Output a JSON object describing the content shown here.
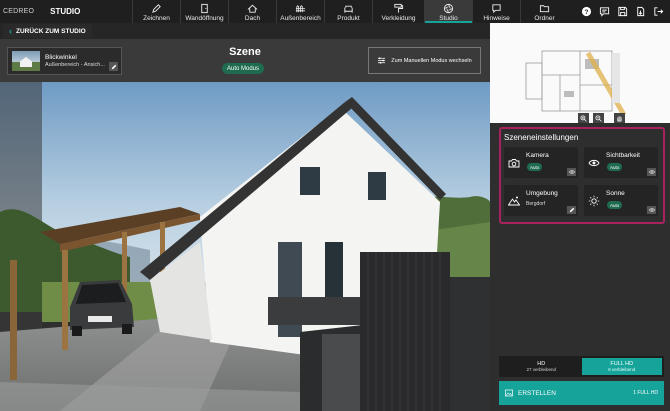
{
  "brand": {
    "logo_text": "CEDREO",
    "section": "STUDIO"
  },
  "nav": [
    {
      "label": "Zeichnen",
      "icon": "pencil-icon"
    },
    {
      "label": "Wandöffnung",
      "icon": "door-icon"
    },
    {
      "label": "Dach",
      "icon": "roof-icon"
    },
    {
      "label": "Außenbereich",
      "icon": "fence-icon"
    },
    {
      "label": "Produkt",
      "icon": "sofa-icon"
    },
    {
      "label": "Verkleidung",
      "icon": "paint-roller-icon"
    },
    {
      "label": "Studio",
      "icon": "camera-aperture-icon",
      "active": true
    },
    {
      "label": "Hinweise",
      "icon": "comment-icon"
    },
    {
      "label": "Ordner",
      "icon": "folder-icon"
    }
  ],
  "topbar_icons": [
    "help-icon",
    "chat-icon",
    "save-icon",
    "export-icon",
    "logout-icon"
  ],
  "subbar": {
    "back_label": "ZURÜCK ZUM STUDIO"
  },
  "view": {
    "title": "Blickwinkel",
    "subtitle": "Außenbereich - Ansich..."
  },
  "scene": {
    "title": "Szene",
    "mode": "Auto Modus",
    "manual_button": "Zum Manuellen Modus wechseln"
  },
  "settings": {
    "title": "Szeneneinstellungen",
    "cards": [
      {
        "label": "Kamera",
        "badge": "Auto",
        "icon": "camera-icon",
        "action": "eye-icon"
      },
      {
        "label": "Sichtbarkeit",
        "badge": "Auto",
        "icon": "eye-icon",
        "action": "eye-icon"
      },
      {
        "label": "Umgebung",
        "sub": "Bergdorf",
        "icon": "mountain-icon",
        "action": "pencil-icon"
      },
      {
        "label": "Sonne",
        "badge": "Auto",
        "icon": "sun-icon",
        "action": "eye-icon"
      }
    ]
  },
  "resolution": {
    "options": [
      {
        "label": "HD",
        "remaining": "27 verbleibend",
        "active": false
      },
      {
        "label": "FULL HD",
        "remaining": "6 verbleibend",
        "active": true
      }
    ]
  },
  "create": {
    "label": "ERSTELLEN",
    "right_label": "1 FULL HD"
  },
  "colors": {
    "accent": "#16a39a",
    "highlight": "#a8235e",
    "badge_green": "#1f6b50"
  }
}
